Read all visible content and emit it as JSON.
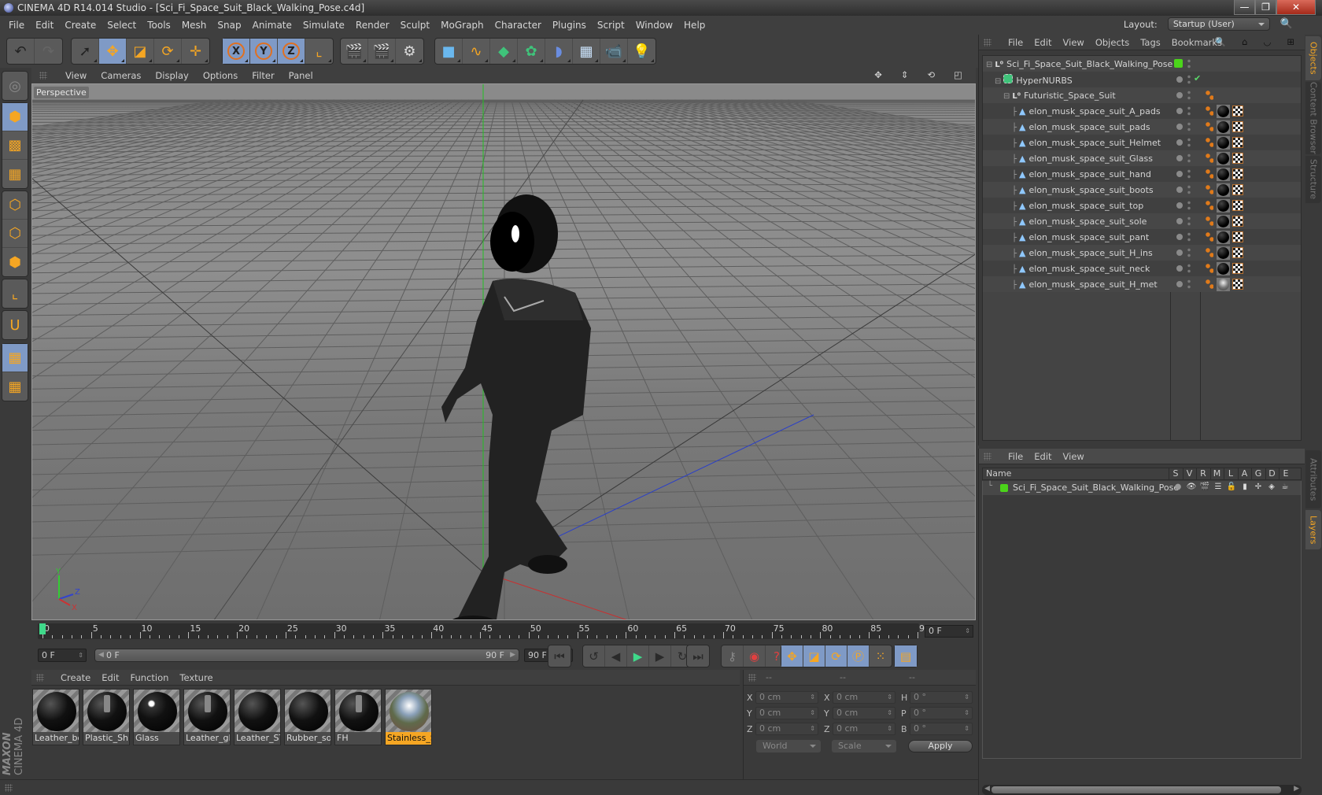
{
  "window": {
    "title": "CINEMA 4D R14.014 Studio - [Sci_Fi_Space_Suit_Black_Walking_Pose.c4d]",
    "controls": [
      "minimize",
      "restore",
      "close"
    ]
  },
  "menubar": {
    "items": [
      "File",
      "Edit",
      "Create",
      "Select",
      "Tools",
      "Mesh",
      "Snap",
      "Animate",
      "Simulate",
      "Render",
      "Sculpt",
      "MoGraph",
      "Character",
      "Plugins",
      "Script",
      "Window",
      "Help"
    ],
    "layout_label": "Layout:",
    "layout_value": "Startup (User)"
  },
  "toolbar": {
    "groups": [
      {
        "tools": [
          {
            "name": "undo",
            "icon": "↶"
          },
          {
            "name": "redo",
            "icon": "↷"
          }
        ]
      },
      {
        "tools": [
          {
            "name": "live-selection",
            "icon": "➚"
          },
          {
            "name": "move",
            "icon": "✥",
            "active": true
          },
          {
            "name": "scale",
            "icon": "◪"
          },
          {
            "name": "rotate",
            "icon": "⟳"
          },
          {
            "name": "last-tool",
            "icon": "✛"
          }
        ]
      },
      {
        "tools": [
          {
            "name": "x-axis",
            "icon": "X",
            "active": true
          },
          {
            "name": "y-axis",
            "icon": "Y",
            "active": true
          },
          {
            "name": "z-axis",
            "icon": "Z",
            "active": true
          },
          {
            "name": "coordinate-system",
            "icon": "⌞"
          }
        ]
      },
      {
        "tools": [
          {
            "name": "render-view",
            "icon": "🎬"
          },
          {
            "name": "render-picture-viewer",
            "icon": "🎬"
          },
          {
            "name": "render-settings",
            "icon": "⚙"
          }
        ]
      },
      {
        "tools": [
          {
            "name": "cube",
            "icon": "■"
          },
          {
            "name": "spline-pen",
            "icon": "∿"
          },
          {
            "name": "subdivision-surface",
            "icon": "◆"
          },
          {
            "name": "array",
            "icon": "✿"
          },
          {
            "name": "deformer",
            "icon": "◗"
          },
          {
            "name": "floor",
            "icon": "▦"
          },
          {
            "name": "camera",
            "icon": "📹"
          },
          {
            "name": "light",
            "icon": "💡"
          }
        ]
      }
    ]
  },
  "left_tools": [
    {
      "name": "make-editable",
      "icon": "◎"
    },
    {
      "name": "model-mode",
      "icon": "⬢",
      "active": true
    },
    {
      "name": "texture-mode",
      "icon": "▩"
    },
    {
      "name": "workplane-mode",
      "icon": "▦"
    },
    {
      "name": "points-mode",
      "icon": "⬡"
    },
    {
      "name": "edges-mode",
      "icon": "⬡"
    },
    {
      "name": "polygons-mode",
      "icon": "⬢"
    },
    {
      "name": "axis-mode",
      "icon": "⌞"
    },
    {
      "name": "snap",
      "icon": "U"
    },
    {
      "name": "locked-workplane",
      "icon": "▦",
      "active": true
    },
    {
      "name": "planar-workplane",
      "icon": "▦"
    }
  ],
  "branding": {
    "line1": "MAXON",
    "line2": "CINEMA 4D"
  },
  "viewport": {
    "menu": [
      "View",
      "Cameras",
      "Display",
      "Options",
      "Filter",
      "Panel"
    ],
    "label": "Perspective",
    "axis_labels": {
      "x": "X",
      "y": "Y",
      "z": "Z"
    },
    "nav_icons": [
      "move-view",
      "zoom-view",
      "rotate-view",
      "maximize-view"
    ]
  },
  "timeline": {
    "start": 0,
    "end": 90,
    "major_ticks": [
      0,
      5,
      10,
      15,
      20,
      25,
      30,
      35,
      40,
      45,
      50,
      55,
      60,
      65,
      70,
      75,
      80,
      85,
      90
    ],
    "current_frame": "0 F",
    "playhead": 0
  },
  "playback": {
    "start_field": "0 F",
    "range_start": "0 F",
    "range_end": "90 F",
    "end_field": "90 F",
    "buttons": [
      {
        "group": 1,
        "items": [
          {
            "name": "go-to-start",
            "icon": "⏮"
          }
        ]
      },
      {
        "group": 2,
        "items": [
          {
            "name": "prev-key",
            "icon": "↺"
          },
          {
            "name": "prev-frame",
            "icon": "◀"
          },
          {
            "name": "play",
            "icon": "▶"
          },
          {
            "name": "next-frame",
            "icon": "▶"
          },
          {
            "name": "next-key",
            "icon": "↻"
          }
        ]
      },
      {
        "group": 3,
        "items": [
          {
            "name": "go-to-end",
            "icon": "⏭"
          }
        ]
      },
      {
        "group": 4,
        "items": [
          {
            "name": "record-keys",
            "icon": "⚷"
          },
          {
            "name": "autokeying",
            "icon": "◉"
          },
          {
            "name": "keyframe-selection",
            "icon": "?"
          }
        ]
      },
      {
        "group": 5,
        "items": [
          {
            "name": "key-position",
            "icon": "✥"
          },
          {
            "name": "key-scale",
            "icon": "◪"
          },
          {
            "name": "key-rotation",
            "icon": "⟳"
          },
          {
            "name": "key-parameter",
            "icon": "Ⓟ"
          },
          {
            "name": "key-pla",
            "icon": "⁙"
          }
        ]
      },
      {
        "group": 6,
        "items": [
          {
            "name": "timeline-window",
            "icon": "▤"
          }
        ]
      }
    ]
  },
  "materials": {
    "menu": [
      "Create",
      "Edit",
      "Function",
      "Texture"
    ],
    "items": [
      {
        "label": "Leather_bo",
        "style": "dark",
        "selected": false
      },
      {
        "label": "Plastic_Shir",
        "style": "hl",
        "selected": false
      },
      {
        "label": "Glass",
        "style": "glass",
        "selected": false
      },
      {
        "label": "Leather_gl_",
        "style": "hl",
        "selected": false
      },
      {
        "label": "Leather_ST_",
        "style": "dark",
        "selected": false
      },
      {
        "label": "Rubber_so",
        "style": "dark",
        "selected": false
      },
      {
        "label": "FH",
        "style": "hl",
        "selected": false
      },
      {
        "label": "Stainless_S",
        "style": "steel",
        "selected": true
      }
    ]
  },
  "coordinates": {
    "headers": [
      "--",
      "--",
      "--"
    ],
    "rows": [
      {
        "pos_label": "X",
        "pos": "0 cm",
        "size_label": "X",
        "size": "0 cm",
        "rot_label": "H",
        "rot": "0 °"
      },
      {
        "pos_label": "Y",
        "pos": "0 cm",
        "size_label": "Y",
        "size": "0 cm",
        "rot_label": "P",
        "rot": "0 °"
      },
      {
        "pos_label": "Z",
        "pos": "0 cm",
        "size_label": "Z",
        "size": "0 cm",
        "rot_label": "B",
        "rot": "0 °"
      }
    ],
    "mode_dropdown": "World",
    "size_dropdown": "Scale",
    "apply_label": "Apply"
  },
  "objects_panel": {
    "menu": [
      "File",
      "Edit",
      "View",
      "Objects",
      "Tags",
      "Bookmarks"
    ],
    "tree": [
      {
        "name": "Sci_Fi_Space_Suit_Black_Walking_Pose",
        "type": "null",
        "level": 0,
        "layer_color": "#4bd41a",
        "tags": []
      },
      {
        "name": "HyperNURBS",
        "type": "nurbs",
        "level": 1,
        "enabled_check": true,
        "tags": []
      },
      {
        "name": "Futuristic_Space_Suit",
        "type": "null",
        "level": 2,
        "tags": [
          "phong"
        ]
      },
      {
        "name": "elon_musk_space_suit_A_pads",
        "type": "polygon",
        "level": 3,
        "tags": [
          "phong",
          "material",
          "uvw"
        ]
      },
      {
        "name": "elon_musk_space_suit_pads",
        "type": "polygon",
        "level": 3,
        "tags": [
          "phong",
          "material",
          "uvw"
        ]
      },
      {
        "name": "elon_musk_space_suit_Helmet",
        "type": "polygon",
        "level": 3,
        "tags": [
          "phong",
          "material",
          "uvw"
        ]
      },
      {
        "name": "elon_musk_space_suit_Glass",
        "type": "polygon",
        "level": 3,
        "tags": [
          "phong",
          "material",
          "uvw"
        ]
      },
      {
        "name": "elon_musk_space_suit_hand",
        "type": "polygon",
        "level": 3,
        "tags": [
          "phong",
          "material",
          "uvw"
        ]
      },
      {
        "name": "elon_musk_space_suit_boots",
        "type": "polygon",
        "level": 3,
        "tags": [
          "phong",
          "material",
          "uvw"
        ]
      },
      {
        "name": "elon_musk_space_suit_top",
        "type": "polygon",
        "level": 3,
        "tags": [
          "phong",
          "material",
          "uvw"
        ]
      },
      {
        "name": "elon_musk_space_suit_sole",
        "type": "polygon",
        "level": 3,
        "tags": [
          "phong",
          "material",
          "uvw"
        ]
      },
      {
        "name": "elon_musk_space_suit_pant",
        "type": "polygon",
        "level": 3,
        "tags": [
          "phong",
          "material",
          "uvw"
        ]
      },
      {
        "name": "elon_musk_space_suit_H_ins",
        "type": "polygon",
        "level": 3,
        "tags": [
          "phong",
          "material",
          "uvw"
        ]
      },
      {
        "name": "elon_musk_space_suit_neck",
        "type": "polygon",
        "level": 3,
        "tags": [
          "phong",
          "material",
          "uvw"
        ]
      },
      {
        "name": "elon_musk_space_suit_H_met",
        "type": "polygon",
        "level": 3,
        "tags": [
          "phong",
          "material-steel",
          "uvw"
        ]
      }
    ]
  },
  "layers_panel": {
    "menu": [
      "File",
      "Edit",
      "View"
    ],
    "columns": [
      "Name",
      "S",
      "V",
      "R",
      "M",
      "L",
      "A",
      "G",
      "D",
      "E"
    ],
    "rows": [
      {
        "name": "Sci_Fi_Space_Suit_Black_Walking_Pose",
        "color": "#4bd41a"
      }
    ]
  },
  "right_tabs": {
    "top": [
      {
        "label": "Objects",
        "active": true
      },
      {
        "label": "Content Browser",
        "active": false
      },
      {
        "label": "Structure",
        "active": false
      }
    ],
    "bottom": [
      {
        "label": "Attributes",
        "active": false
      },
      {
        "label": "Layers",
        "active": true
      }
    ]
  },
  "colors": {
    "accent": "#f5a623",
    "active_tool": "#7f9ac6",
    "layer_green": "#4bd41a",
    "panel_bg": "#3a3a3a"
  }
}
